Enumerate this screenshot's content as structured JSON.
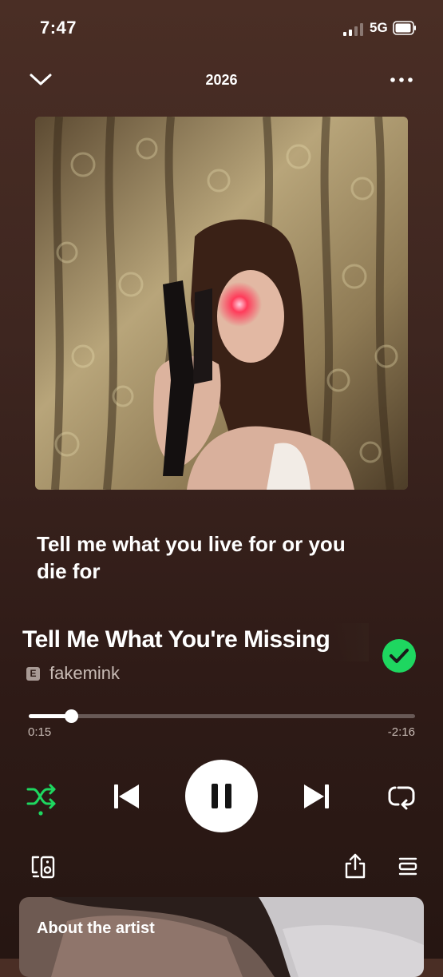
{
  "status_bar": {
    "time": "7:47",
    "network": "5G",
    "icons": [
      "signal-icon",
      "battery-icon"
    ]
  },
  "header": {
    "title": "2026",
    "icons": [
      "chevron-down-icon",
      "more-icon"
    ]
  },
  "artwork": {
    "description_icon": "album-artwork"
  },
  "lyric": {
    "text": "Tell me what you live for or you die for"
  },
  "track": {
    "title": "Tell Me What You're Missing",
    "explicit_badge": "E",
    "artist": "fakemink",
    "liked": true
  },
  "progress": {
    "elapsed": "0:15",
    "remaining": "-2:16",
    "fraction": 0.11
  },
  "controls": {
    "icons": [
      "shuffle-icon",
      "previous-icon",
      "pause-icon",
      "next-icon",
      "repeat-icon"
    ],
    "shuffle_active": true
  },
  "bottom_row": {
    "icons": [
      "connect-device-icon",
      "share-icon",
      "queue-icon"
    ]
  },
  "about": {
    "title": "About the artist"
  },
  "colors": {
    "accent": "#1ed760",
    "background": "#3e2620"
  }
}
